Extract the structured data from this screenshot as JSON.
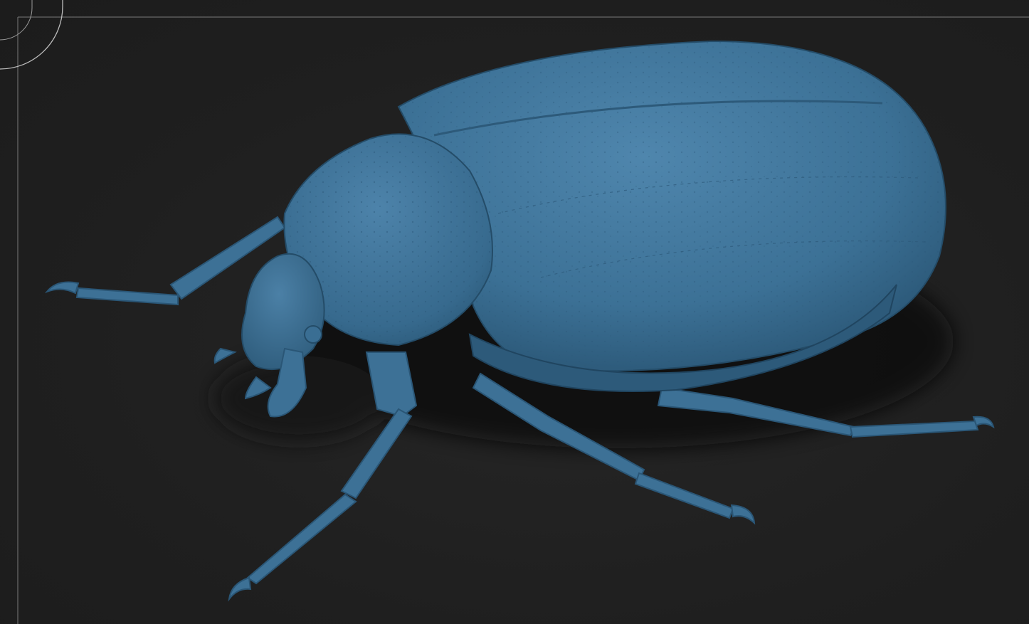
{
  "viewport": {
    "background_color": "#1f1f1f",
    "frame_line_color": "#8a8a8a"
  },
  "navigation_gizmo": {
    "icon": "rotation-gizmo-icon",
    "color": "#bdbdbd"
  },
  "model": {
    "subject": "beetle-sculpt",
    "material_color": "#3d7196",
    "highlight_color": "#5a8db3",
    "shadow_color": "#244c68"
  }
}
